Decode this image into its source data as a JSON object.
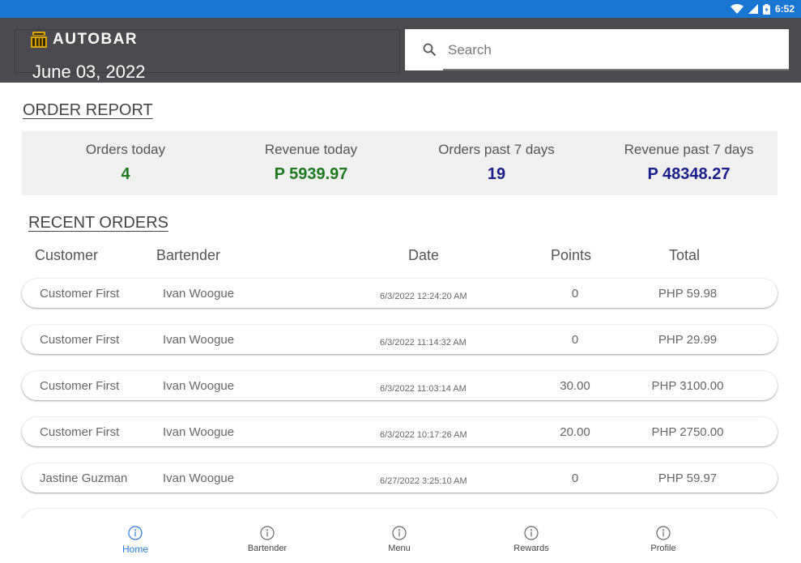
{
  "status_bar": {
    "time": "6:52"
  },
  "header": {
    "app_name": "AUTOBAR",
    "date": "June 03, 2022",
    "search_placeholder": "Search"
  },
  "order_report": {
    "title": "ORDER REPORT",
    "stats": [
      {
        "label": "Orders today",
        "value": "4",
        "color": "#1e7a1e"
      },
      {
        "label": "Revenue today",
        "value": "P 5939.97",
        "color": "#1e7a1e"
      },
      {
        "label": "Orders past 7 days",
        "value": "19",
        "color": "#1a1f8c"
      },
      {
        "label": "Revenue past 7 days",
        "value": "P 48348.27",
        "color": "#1a1f8c"
      }
    ]
  },
  "recent_orders": {
    "title": "RECENT ORDERS",
    "columns": [
      "Customer",
      "Bartender",
      "Date",
      "Points",
      "Total"
    ],
    "rows": [
      {
        "customer": "Customer First",
        "bartender": "Ivan Woogue",
        "date": "6/3/2022 12:24:20 AM",
        "points": "0",
        "total": "PHP 59.98"
      },
      {
        "customer": "Customer First",
        "bartender": "Ivan Woogue",
        "date": "6/3/2022 11:14:32 AM",
        "points": "0",
        "total": "PHP 29.99"
      },
      {
        "customer": "Customer First",
        "bartender": "Ivan Woogue",
        "date": "6/3/2022 11:03:14 AM",
        "points": "30.00",
        "total": "PHP 3100.00"
      },
      {
        "customer": "Customer First",
        "bartender": "Ivan Woogue",
        "date": "6/3/2022 10:17:26 AM",
        "points": "20.00",
        "total": "PHP 2750.00"
      },
      {
        "customer": "Jastine Guzman",
        "bartender": "Ivan Woogue",
        "date": "6/27/2022 3:25:10 AM",
        "points": "0",
        "total": "PHP 59.97"
      }
    ]
  },
  "bottom_nav": {
    "active_color": "#2a7be0",
    "items": [
      {
        "label": "Home",
        "icon": "info-circle-icon",
        "active": true
      },
      {
        "label": "Bartender",
        "icon": "info-circle-icon",
        "active": false
      },
      {
        "label": "Menu",
        "icon": "info-circle-icon",
        "active": false
      },
      {
        "label": "Rewards",
        "icon": "info-circle-icon",
        "active": false
      },
      {
        "label": "Profile",
        "icon": "info-circle-icon",
        "active": false
      }
    ]
  }
}
